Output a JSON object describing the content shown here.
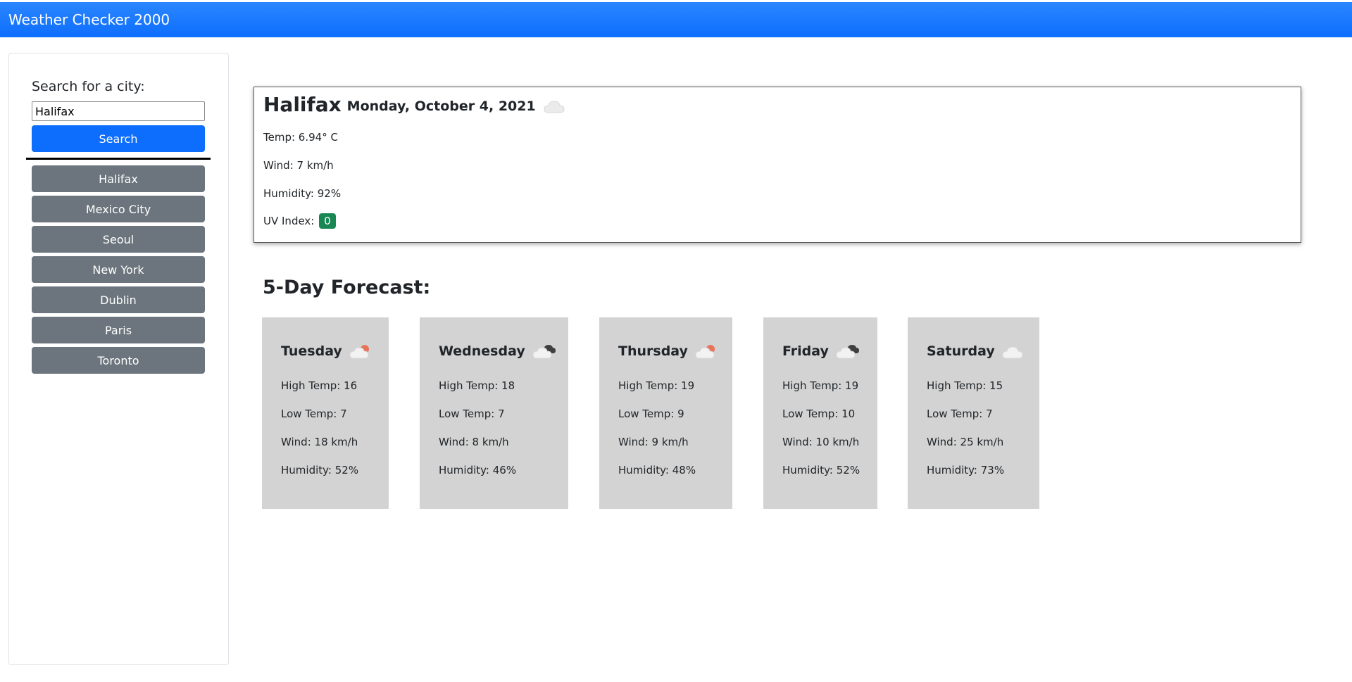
{
  "app": {
    "title": "Weather Checker 2000"
  },
  "search": {
    "label": "Search for a city:",
    "value": "Halifax",
    "button_label": "Search"
  },
  "history": [
    "Halifax",
    "Mexico City",
    "Seoul",
    "New York",
    "Dublin",
    "Paris",
    "Toronto"
  ],
  "current": {
    "city": "Halifax",
    "date": "Monday, October 4, 2021",
    "icon": "cloud-icon",
    "temp": "Temp: 6.94° C",
    "wind": "Wind: 7 km/h",
    "humidity": "Humidity: 92%",
    "uv_label": "UV Index:",
    "uv_value": "0"
  },
  "forecast": {
    "title": "5-Day Forecast:",
    "days": [
      {
        "day": "Tuesday",
        "icon": "cloud-sun-icon",
        "high": "High Temp: 16",
        "low": "Low Temp: 7",
        "wind": "Wind: 18 km/h",
        "humidity": "Humidity: 52%"
      },
      {
        "day": "Wednesday",
        "icon": "broken-clouds-icon",
        "high": "High Temp: 18",
        "low": "Low Temp: 7",
        "wind": "Wind: 8 km/h",
        "humidity": "Humidity: 46%"
      },
      {
        "day": "Thursday",
        "icon": "cloud-sun-icon",
        "high": "High Temp: 19",
        "low": "Low Temp: 9",
        "wind": "Wind: 9 km/h",
        "humidity": "Humidity: 48%"
      },
      {
        "day": "Friday",
        "icon": "broken-clouds-icon",
        "high": "High Temp: 19",
        "low": "Low Temp: 10",
        "wind": "Wind: 10 km/h",
        "humidity": "Humidity: 52%"
      },
      {
        "day": "Saturday",
        "icon": "cloud-icon",
        "high": "High Temp: 15",
        "low": "Low Temp: 7",
        "wind": "Wind: 25 km/h",
        "humidity": "Humidity: 73%"
      }
    ]
  },
  "colors": {
    "primary": "#0d6efd",
    "secondary": "#6c757d",
    "uv_badge": "#198754",
    "card_bg": "#d3d3d3"
  }
}
